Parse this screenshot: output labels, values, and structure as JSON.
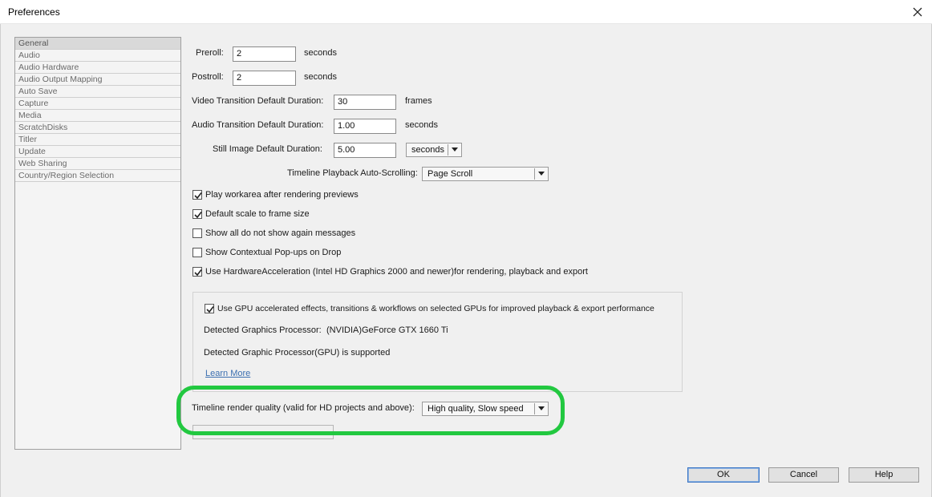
{
  "window": {
    "title": "Preferences"
  },
  "sidebar": {
    "items": [
      {
        "label": "General"
      },
      {
        "label": "Audio"
      },
      {
        "label": "Audio Hardware"
      },
      {
        "label": "Audio Output Mapping"
      },
      {
        "label": "Auto Save"
      },
      {
        "label": "Capture"
      },
      {
        "label": "Media"
      },
      {
        "label": "ScratchDisks"
      },
      {
        "label": "Titler"
      },
      {
        "label": "Update"
      },
      {
        "label": "Web Sharing"
      },
      {
        "label": "Country/Region Selection"
      }
    ]
  },
  "general": {
    "preroll": {
      "label": "Preroll:",
      "value": "2",
      "unit": "seconds"
    },
    "postroll": {
      "label": "Postroll:",
      "value": "2",
      "unit": "seconds"
    },
    "video_transition": {
      "label": "Video Transition Default Duration:",
      "value": "30",
      "unit": "frames"
    },
    "audio_transition": {
      "label": "Audio Transition Default Duration:",
      "value": "1.00",
      "unit": "seconds"
    },
    "still_image": {
      "label": "Still Image Default Duration:",
      "value": "5.00",
      "unit": "seconds"
    },
    "auto_scroll": {
      "label": "Timeline Playback Auto-Scrolling:",
      "value": "Page Scroll"
    },
    "checkboxes": [
      {
        "label": "Play workarea after rendering previews",
        "checked": true
      },
      {
        "label": "Default scale to frame size",
        "checked": true
      },
      {
        "label": "Show all do not show again messages",
        "checked": false
      },
      {
        "label": "Show Contextual Pop-ups on Drop",
        "checked": false
      },
      {
        "label": "Use HardwareAcceleration (Intel HD Graphics 2000 and newer)for rendering, playback and export",
        "checked": true
      }
    ],
    "gpu": {
      "checkbox_label": "Use GPU accelerated effects, transitions & workflows on selected GPUs for improved playback & export performance",
      "checked": true,
      "detected_label": "Detected Graphics Processor:",
      "detected_value": "(NVIDIA)GeForce GTX 1660 Ti",
      "supported_text": "Detected Graphic Processor(GPU) is supported",
      "learn_more": "Learn More"
    },
    "render_quality": {
      "label": "Timeline render quality (valid for HD projects and above):",
      "value": "High quality, Slow speed"
    }
  },
  "buttons": {
    "ok": "OK",
    "cancel": "Cancel",
    "help": "Help"
  },
  "colors": {
    "highlight": "#22c840",
    "link": "#3b6fb0"
  }
}
